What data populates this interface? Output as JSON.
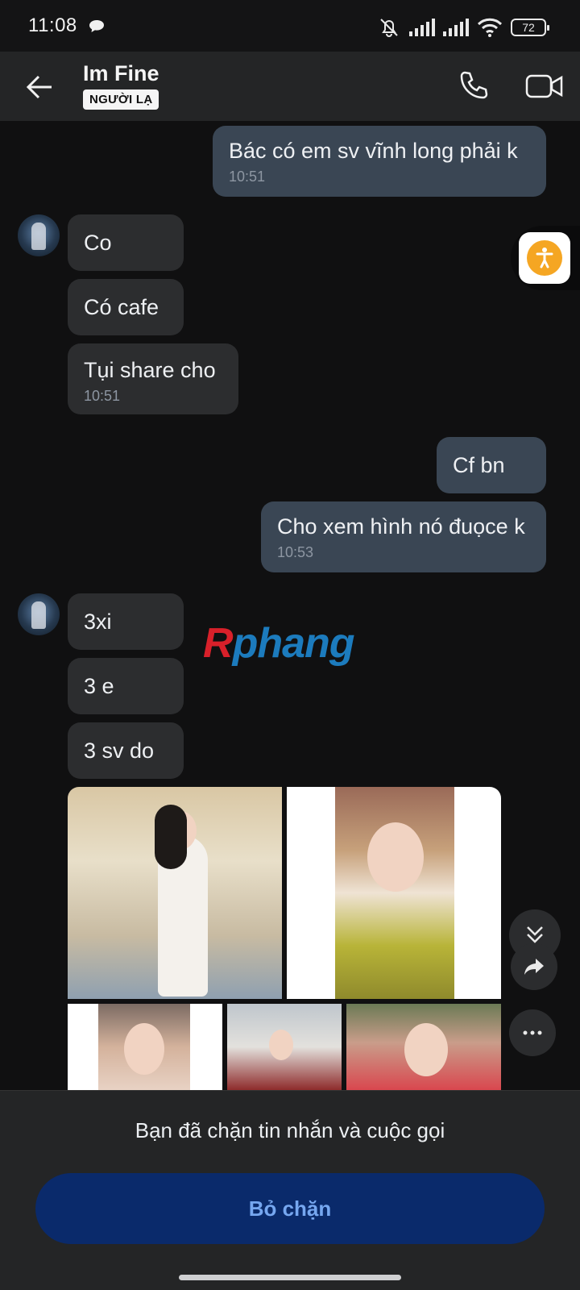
{
  "status_bar": {
    "time": "11:08",
    "battery": "72"
  },
  "header": {
    "contact_name": "Im Fine",
    "badge": "NGƯỜI LẠ"
  },
  "messages": [
    {
      "side": "out",
      "text": "Bác có em sv vĩnh long phải k",
      "time": "10:51"
    },
    {
      "side": "in",
      "text": "Co"
    },
    {
      "side": "in",
      "text": "Có cafe"
    },
    {
      "side": "in",
      "text": "Tụi share cho",
      "time": "10:51"
    },
    {
      "side": "out",
      "text": "Cf bn"
    },
    {
      "side": "out",
      "text": "Cho xem hình nó đuọce k",
      "time": "10:53"
    },
    {
      "side": "in",
      "text": "3xi"
    },
    {
      "side": "in",
      "text": "3 e"
    },
    {
      "side": "in",
      "text": "3 sv do"
    }
  ],
  "watermark": {
    "r": "R",
    "rest": "phang"
  },
  "bottom": {
    "blocked_text": "Bạn đã chặn tin nhắn và cuộc gọi",
    "unblock_label": "Bỏ chặn"
  },
  "colors": {
    "outgoing_bubble": "#3a4654",
    "incoming_bubble": "#2c2d2f",
    "unblock_button": "#0a2a6b",
    "accessibility_accent": "#f5a623"
  },
  "icons": [
    "back-arrow-icon",
    "phone-icon",
    "video-camera-icon",
    "chevrons-down-icon",
    "share-forward-icon",
    "more-horizontal-icon",
    "accessibility-icon"
  ]
}
